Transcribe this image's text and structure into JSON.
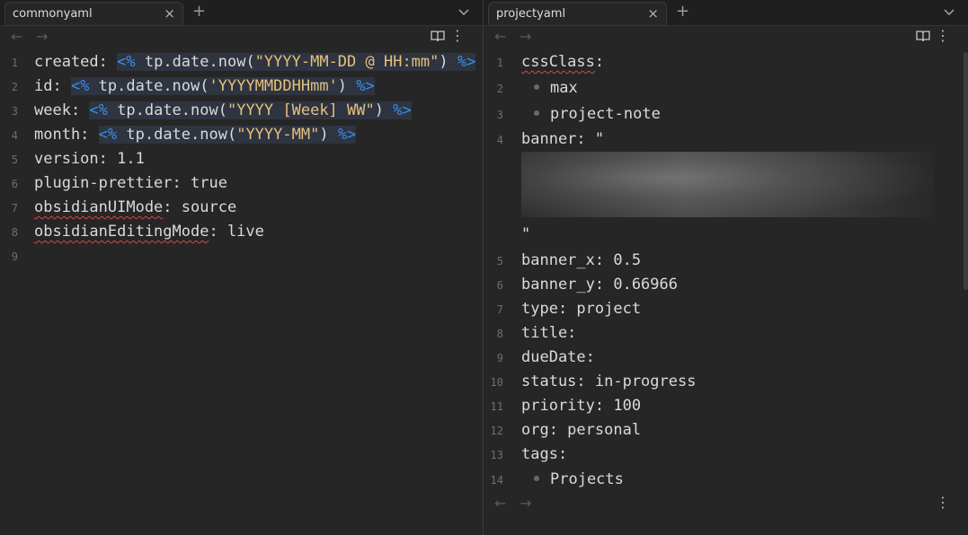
{
  "left": {
    "tab_title": "commonyaml",
    "tab_close": "×",
    "tab_new": "+",
    "lines": [
      {
        "n": "1",
        "parts": [
          {
            "t": "created",
            "c": "plain"
          },
          {
            "t": ": ",
            "c": "plain"
          },
          {
            "t": "<%",
            "c": "tpd"
          },
          {
            "t": " tp.date.now(",
            "c": "tp"
          },
          {
            "t": "\"YYYY-MM-DD @ HH:mm\"",
            "c": "str"
          },
          {
            "t": ") ",
            "c": "tp"
          },
          {
            "t": "%>",
            "c": "tpd"
          }
        ]
      },
      {
        "n": "2",
        "parts": [
          {
            "t": "id: ",
            "c": "plain"
          },
          {
            "t": "<%",
            "c": "tpd"
          },
          {
            "t": " tp.date.now(",
            "c": "tp"
          },
          {
            "t": "'YYYYMMDDHHmm'",
            "c": "str"
          },
          {
            "t": ") ",
            "c": "tp"
          },
          {
            "t": "%>",
            "c": "tpd"
          }
        ]
      },
      {
        "n": "3",
        "parts": [
          {
            "t": "week: ",
            "c": "plain"
          },
          {
            "t": "<%",
            "c": "tpd"
          },
          {
            "t": " tp.date.now(",
            "c": "tp"
          },
          {
            "t": "\"YYYY [Week] WW\"",
            "c": "str"
          },
          {
            "t": ") ",
            "c": "tp"
          },
          {
            "t": "%>",
            "c": "tpd"
          }
        ]
      },
      {
        "n": "4",
        "parts": [
          {
            "t": "month: ",
            "c": "plain"
          },
          {
            "t": "<%",
            "c": "tpd"
          },
          {
            "t": " tp.date.now(",
            "c": "tp"
          },
          {
            "t": "\"YYYY-MM\"",
            "c": "str"
          },
          {
            "t": ") ",
            "c": "tp"
          },
          {
            "t": "%>",
            "c": "tpd"
          }
        ]
      },
      {
        "n": "5",
        "parts": [
          {
            "t": "version: 1.1",
            "c": "plain"
          }
        ]
      },
      {
        "n": "6",
        "parts": [
          {
            "t": "plugin-prettier: true",
            "c": "plain"
          }
        ]
      },
      {
        "n": "7",
        "parts": [
          {
            "t": "obsidianUIMode",
            "c": "sq"
          },
          {
            "t": ": source",
            "c": "plain"
          }
        ]
      },
      {
        "n": "8",
        "parts": [
          {
            "t": "obsidianEditingMode",
            "c": "sq"
          },
          {
            "t": ": live",
            "c": "plain"
          }
        ]
      },
      {
        "n": "9",
        "parts": []
      }
    ]
  },
  "right": {
    "tab_title": "projectyaml",
    "tab_close": "×",
    "tab_new": "+",
    "lines": [
      {
        "n": "1",
        "parts": [
          {
            "t": "cssClass",
            "c": "sq"
          },
          {
            "t": ":",
            "c": "plain"
          }
        ]
      },
      {
        "n": "2",
        "bullet": true,
        "parts": [
          {
            "t": "max",
            "c": "plain"
          }
        ]
      },
      {
        "n": "3",
        "bullet": true,
        "parts": [
          {
            "t": "project-note",
            "c": "plain"
          }
        ]
      },
      {
        "n": "4",
        "parts": [
          {
            "t": "banner: \"",
            "c": "plain"
          }
        ]
      },
      {
        "n": "",
        "parts": [
          {
            "t": "\"",
            "c": "plain"
          }
        ]
      },
      {
        "n": "5",
        "parts": [
          {
            "t": "banner_x: 0.5",
            "c": "plain"
          }
        ]
      },
      {
        "n": "6",
        "parts": [
          {
            "t": "banner_y: 0.66966",
            "c": "plain"
          }
        ]
      },
      {
        "n": "7",
        "parts": [
          {
            "t": "type: project",
            "c": "plain"
          }
        ]
      },
      {
        "n": "8",
        "parts": [
          {
            "t": "title:",
            "c": "plain"
          }
        ]
      },
      {
        "n": "9",
        "parts": [
          {
            "t": "dueDate:",
            "c": "plain"
          }
        ]
      },
      {
        "n": "10",
        "parts": [
          {
            "t": "status: in-progress",
            "c": "plain"
          }
        ]
      },
      {
        "n": "11",
        "parts": [
          {
            "t": "priority: 100",
            "c": "plain"
          }
        ]
      },
      {
        "n": "12",
        "parts": [
          {
            "t": "org: personal",
            "c": "plain"
          }
        ]
      },
      {
        "n": "13",
        "parts": [
          {
            "t": "tags:",
            "c": "plain"
          }
        ]
      },
      {
        "n": "14",
        "bullet": true,
        "parts": [
          {
            "t": "Projects",
            "c": "plain"
          }
        ]
      }
    ]
  },
  "icons": {
    "back": "←",
    "forward": "→",
    "more": "⋮"
  }
}
